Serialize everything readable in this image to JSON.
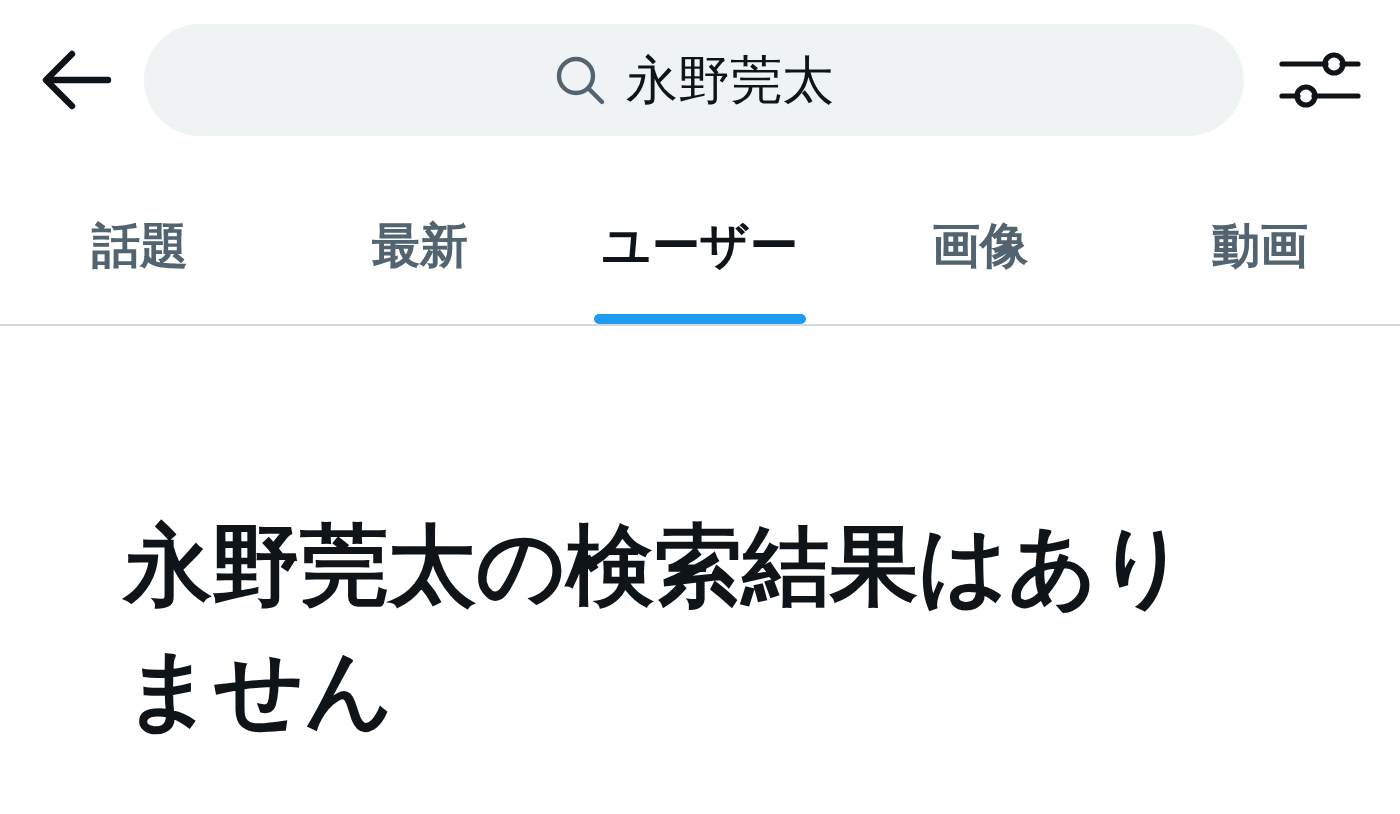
{
  "search": {
    "value": "永野莞太"
  },
  "tabs": [
    {
      "label": "話題",
      "selected": false
    },
    {
      "label": "最新",
      "selected": false
    },
    {
      "label": "ユーザー",
      "selected": true
    },
    {
      "label": "画像",
      "selected": false
    },
    {
      "label": "動画",
      "selected": false
    }
  ],
  "empty_state": {
    "title": "永野莞太の検索結果はありません"
  }
}
